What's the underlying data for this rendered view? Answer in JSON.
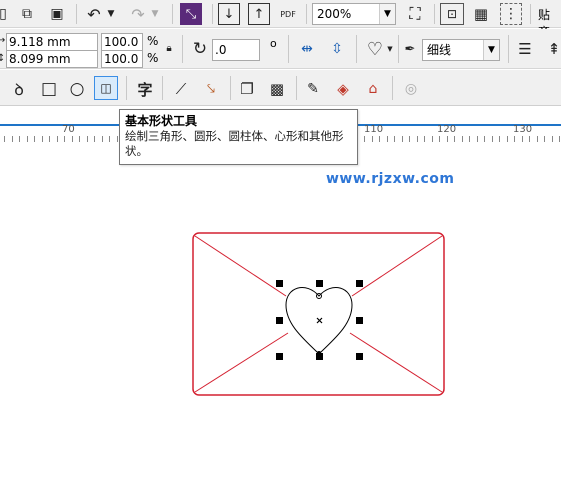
{
  "toolbar": {
    "zoom_value": "200%",
    "paste_label": "贴齐",
    "pdf_label": "PDF"
  },
  "property_bar": {
    "width_value": "9.118 mm",
    "height_value": "8.099 mm",
    "scale_x": "100.0",
    "scale_y": "100.0",
    "percent_symbol": "%",
    "rotation_value": ".0",
    "degree_symbol": "o",
    "outline_width": "细线"
  },
  "toolbox": {
    "text_tool_label": "字"
  },
  "ruler": {
    "labels": [
      "70",
      "110",
      "120",
      "130"
    ]
  },
  "tooltip": {
    "title": "基本形状工具",
    "description": "绘制三角形、圆形、圆柱体、心形和其他形状。"
  },
  "watermark": "www.rjzxw.com",
  "colors": {
    "envelope_stroke": "#d42030",
    "heart_stroke": "#000000",
    "ruler_accent": "#1e74c8",
    "watermark": "#2e76d6"
  }
}
